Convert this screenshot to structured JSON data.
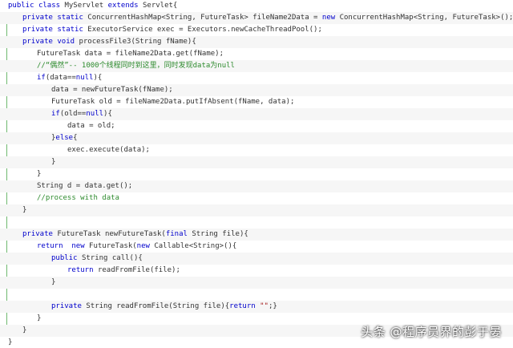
{
  "code": {
    "lines": [
      [
        {
          "t": "public ",
          "c": "kw"
        },
        {
          "t": "class ",
          "c": "kw"
        },
        {
          "t": "MyServlet "
        },
        {
          "t": "extends ",
          "c": "kw"
        },
        {
          "t": "Servlet{"
        }
      ],
      [
        {
          "t": "private ",
          "c": "kw"
        },
        {
          "t": "static ",
          "c": "kw"
        },
        {
          "t": "ConcurrentHashMap<String, FutureTask> fileName2Data = "
        },
        {
          "t": "new ",
          "c": "kw"
        },
        {
          "t": "ConcurrentHashMap<String, FutureTask>();"
        }
      ],
      [
        {
          "t": "private ",
          "c": "kw"
        },
        {
          "t": "static ",
          "c": "kw"
        },
        {
          "t": "ExecutorService exec = Executors.newCacheThreadPool();"
        }
      ],
      [
        {
          "t": "private ",
          "c": "kw"
        },
        {
          "t": "void ",
          "c": "kw"
        },
        {
          "t": "processFile3(String fName){"
        }
      ],
      [
        {
          "t": "FutureTask data = fileName2Data.get(fName);"
        }
      ],
      [
        {
          "t": "//“偶然”-- 1000个线程同时到这里，同时发现data为null",
          "c": "cm"
        }
      ],
      [
        {
          "t": "if",
          "c": "kw"
        },
        {
          "t": "(data=="
        },
        {
          "t": "null",
          "c": "kw"
        },
        {
          "t": "){"
        }
      ],
      [
        {
          "t": "data = newFutureTask(fName);"
        }
      ],
      [
        {
          "t": "FutureTask old = fileName2Data.putIfAbsent(fName, data);"
        }
      ],
      [
        {
          "t": "if",
          "c": "kw"
        },
        {
          "t": "(old=="
        },
        {
          "t": "null",
          "c": "kw"
        },
        {
          "t": "){"
        }
      ],
      [
        {
          "t": "data = old;"
        }
      ],
      [
        {
          "t": "}"
        },
        {
          "t": "else",
          "c": "kw"
        },
        {
          "t": "{"
        }
      ],
      [
        {
          "t": "exec.execute(data);"
        }
      ],
      [
        {
          "t": "}"
        }
      ],
      [
        {
          "t": "}"
        }
      ],
      [
        {
          "t": "String d = data.get();"
        }
      ],
      [
        {
          "t": "//process with data",
          "c": "cm"
        }
      ],
      [
        {
          "t": "}"
        }
      ],
      [],
      [
        {
          "t": "private ",
          "c": "kw"
        },
        {
          "t": "FutureTask newFutureTask("
        },
        {
          "t": "final ",
          "c": "kw"
        },
        {
          "t": "String file){"
        }
      ],
      [
        {
          "t": "return  ",
          "c": "kw"
        },
        {
          "t": "new ",
          "c": "kw"
        },
        {
          "t": "FutureTask("
        },
        {
          "t": "new ",
          "c": "kw"
        },
        {
          "t": "Callable<String>(){"
        }
      ],
      [
        {
          "t": "public ",
          "c": "kw"
        },
        {
          "t": "String call(){"
        }
      ],
      [
        {
          "t": "return ",
          "c": "kw"
        },
        {
          "t": "readFromFile(file);"
        }
      ],
      [
        {
          "t": "}"
        }
      ],
      [],
      [
        {
          "t": "private ",
          "c": "kw"
        },
        {
          "t": "String readFromFile(String file){"
        },
        {
          "t": "return ",
          "c": "kw"
        },
        {
          "t": "\"\"",
          "c": "str"
        },
        {
          "t": ";}"
        }
      ],
      [
        {
          "t": "}"
        }
      ],
      [
        {
          "t": "}"
        }
      ],
      [
        {
          "t": "}"
        }
      ]
    ]
  },
  "watermark": {
    "text": "头条 @程序员界的彭于晏"
  }
}
